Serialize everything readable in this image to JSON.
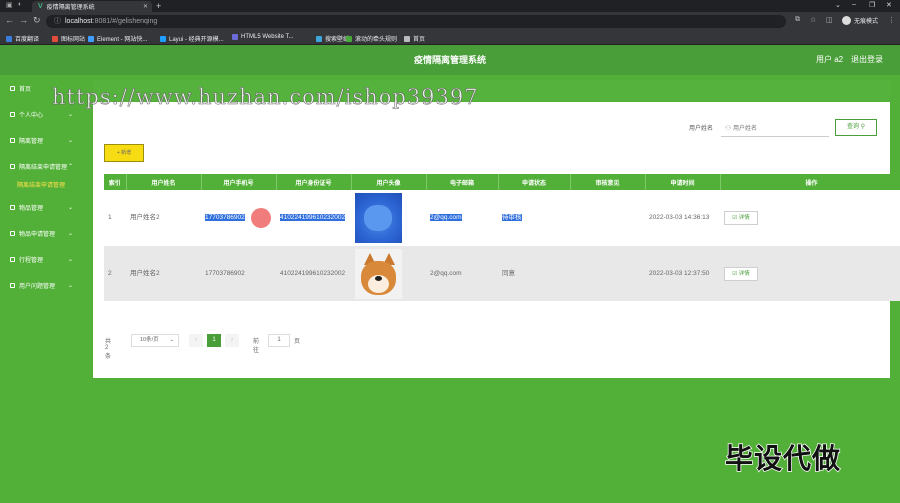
{
  "browser": {
    "tab_title": "疫情隔离管理系统",
    "url_host": "localhost",
    "url_path": ":8081/#/gelishenqing",
    "profile_label": "无痕模式",
    "bookmarks": [
      {
        "label": "百度翻译",
        "color": "#3b7ddd"
      },
      {
        "label": "图标网站",
        "color": "#e34b3b"
      },
      {
        "label": "Element - 网站快...",
        "color": "#409eff"
      },
      {
        "label": "Layui - 经典开源模...",
        "color": "#1e9fff"
      },
      {
        "label": "HTML5 Website T...",
        "color": "#6b6bd8"
      },
      {
        "label": "搜索壁纸",
        "color": "#3da5d9"
      },
      {
        "label": "滚动的牵头规则",
        "color": "#49a83b"
      },
      {
        "label": "首页",
        "color": "#bbbbbb"
      }
    ]
  },
  "header": {
    "title": "疫情隔离管理系统",
    "user": "用户 a2",
    "logout": "退出登录"
  },
  "sidebar": {
    "items": [
      {
        "label": "首页",
        "caret": ""
      },
      {
        "label": "个人中心",
        "caret": "⌄"
      },
      {
        "label": "隔离管理",
        "caret": "⌄"
      },
      {
        "label": "隔离结束申请管理",
        "caret": "⌃"
      },
      {
        "label": "隔离结束申请管理",
        "sub": true
      },
      {
        "label": "物品管理",
        "caret": "⌄"
      },
      {
        "label": "物品申请管理",
        "caret": "⌄"
      },
      {
        "label": "行程管理",
        "caret": "⌄"
      },
      {
        "label": "用户问题管理",
        "caret": "⌄"
      }
    ]
  },
  "search": {
    "label": "用户姓名",
    "placeholder": "用户姓名",
    "query_button": "查询"
  },
  "add_button": "+ 新增",
  "table": {
    "headers": [
      "索引",
      "用户姓名",
      "用户手机号",
      "用户身份证号",
      "用户头像",
      "电子邮箱",
      "申请状态",
      "审核意见",
      "申请时间",
      "操作"
    ],
    "rows": [
      {
        "index": "1",
        "name": "用户姓名2",
        "phone": "17703786902",
        "id_card": "410224199610232002",
        "avatar": "blue-dog-photo",
        "email": "2@qq.com",
        "status": "待审核",
        "review": "",
        "time": "2022-03-03 14:36:13",
        "action": "详情"
      },
      {
        "index": "2",
        "name": "用户姓名2",
        "phone": "17703786902",
        "id_card": "410224199610232002",
        "avatar": "shiba-dog-photo",
        "email": "2@qq.com",
        "status": "同意",
        "review": "",
        "time": "2022-03-03 12:37:50",
        "action": "详情"
      }
    ]
  },
  "pagination": {
    "total": "共 2 条",
    "page_size": "10条/页",
    "prev": "‹",
    "current": "1",
    "next": "›",
    "goto_label": "前往",
    "goto_value": "1",
    "page_suffix": "页"
  },
  "overlay": {
    "watermark": "https://www.huzhan.com/ishop39397",
    "bottom_text": "毕设代做"
  }
}
